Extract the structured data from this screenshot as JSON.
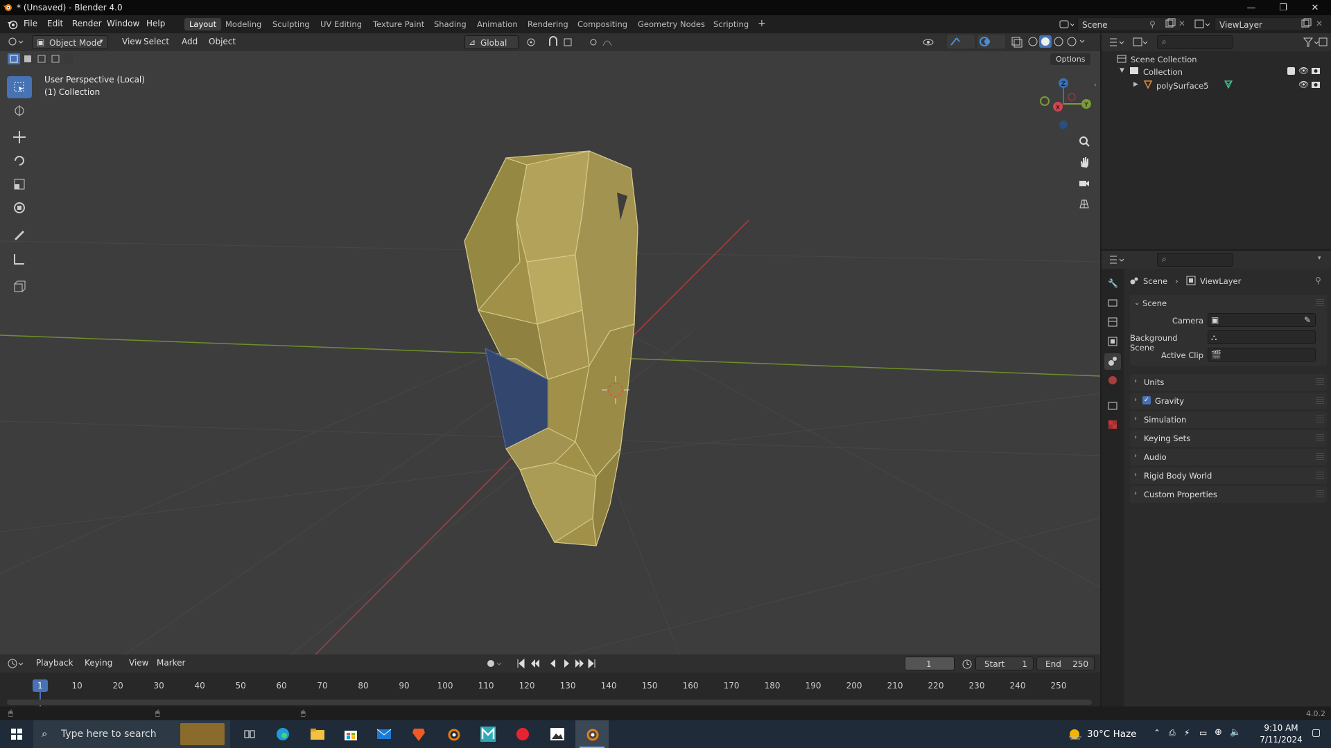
{
  "window": {
    "title": "* (Unsaved) - Blender 4.0"
  },
  "menu": [
    "File",
    "Edit",
    "Render",
    "Window",
    "Help"
  ],
  "workspaces": [
    {
      "label": "Layout",
      "active": true
    },
    {
      "label": "Modeling"
    },
    {
      "label": "Sculpting"
    },
    {
      "label": "UV Editing"
    },
    {
      "label": "Texture Paint"
    },
    {
      "label": "Shading"
    },
    {
      "label": "Animation"
    },
    {
      "label": "Rendering"
    },
    {
      "label": "Compositing"
    },
    {
      "label": "Geometry Nodes"
    },
    {
      "label": "Scripting"
    }
  ],
  "topright": {
    "scene": "Scene",
    "viewlayer": "ViewLayer"
  },
  "viewport": {
    "mode": "Object Mode",
    "menus": [
      "View",
      "Select",
      "Add",
      "Object"
    ],
    "transform_orientation": "Global",
    "options": "Options",
    "info_line1": "User Perspective (Local)",
    "info_line2": "(1) Collection",
    "gizmo": {
      "x": "X",
      "y": "Y",
      "z": "Z"
    }
  },
  "outliner": {
    "root": "Scene Collection",
    "collection": "Collection",
    "object": "polySurface5"
  },
  "properties": {
    "breadcrumb_scene": "Scene",
    "breadcrumb_layer": "ViewLayer",
    "panel_title": "Scene",
    "fields": [
      {
        "label": "Camera"
      },
      {
        "label": "Background Scene"
      },
      {
        "label": "Active Clip"
      }
    ],
    "sections": [
      {
        "label": "Units"
      },
      {
        "label": "Gravity",
        "checked": true
      },
      {
        "label": "Simulation"
      },
      {
        "label": "Keying Sets"
      },
      {
        "label": "Audio"
      },
      {
        "label": "Rigid Body World"
      },
      {
        "label": "Custom Properties"
      }
    ]
  },
  "timeline": {
    "menus": [
      "Playback",
      "Keying",
      "View",
      "Marker"
    ],
    "current_frame": "1",
    "start_label": "Start",
    "start": "1",
    "end_label": "End",
    "end": "250",
    "ticks": [
      "1",
      "10",
      "20",
      "30",
      "40",
      "50",
      "60",
      "70",
      "80",
      "90",
      "100",
      "110",
      "120",
      "130",
      "140",
      "150",
      "160",
      "170",
      "180",
      "190",
      "200",
      "210",
      "220",
      "230",
      "240",
      "250"
    ]
  },
  "status": {
    "version": "4.0.2"
  },
  "taskbar": {
    "search_placeholder": "Type here to search",
    "weather": "30°C  Haze",
    "time": "9:10 AM",
    "date": "7/11/2024"
  },
  "colors": {
    "accent": "#4772b3",
    "mesh": "#a8984f",
    "selected_face": "#33466e",
    "x_axis": "#a83e45",
    "y_axis": "#7b9c36"
  }
}
